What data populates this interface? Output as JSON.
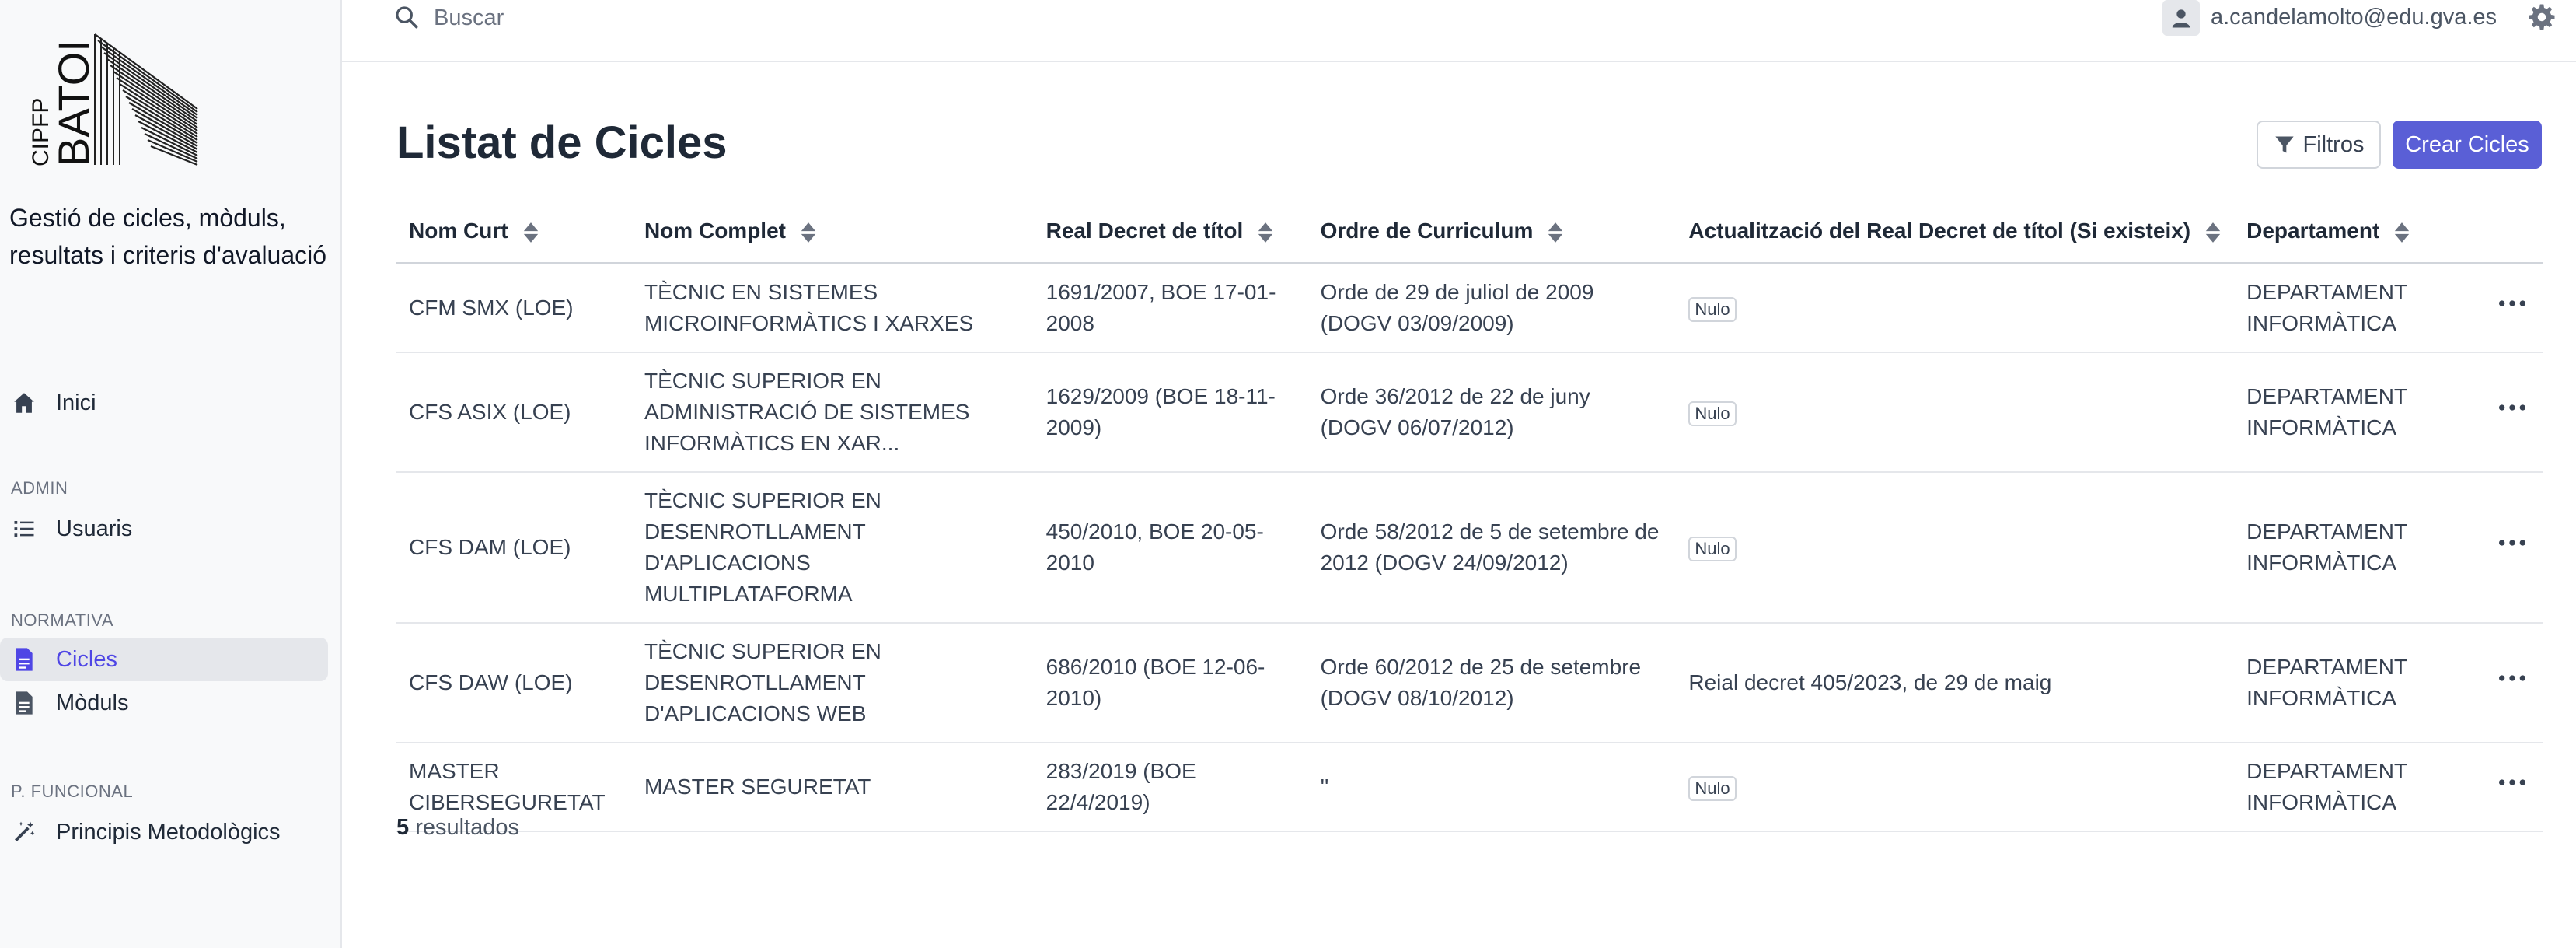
{
  "sidebar": {
    "logo_text": "CIPFP BATOI",
    "tagline": "Gestió de cicles, mòduls, resultats i criteris d'avaluació",
    "items": [
      {
        "label": "Inici",
        "icon": "home-icon"
      },
      {
        "section": "ADMIN"
      },
      {
        "label": "Usuaris",
        "icon": "list-icon"
      },
      {
        "section": "NORMATIVA"
      },
      {
        "label": "Cicles",
        "icon": "document-icon",
        "active": true
      },
      {
        "label": "Mòduls",
        "icon": "document-icon"
      },
      {
        "section": "P. FUNCIONAL"
      },
      {
        "label": "Principis Metodològics",
        "icon": "magic-wand-icon"
      }
    ]
  },
  "topbar": {
    "search_placeholder": "Buscar",
    "user_email": "a.candelamolto@edu.gva.es"
  },
  "page": {
    "title": "Listat de Cicles",
    "filter_label": "Filtros",
    "create_label": "Crear Cicles",
    "accent_color": "#5a5fd6"
  },
  "table": {
    "columns": [
      "Nom Curt",
      "Nom Complet",
      "Real Decret de títol",
      "Ordre de Curriculum",
      "Actualització del Real Decret de títol (Si existeix)",
      "Departament"
    ],
    "rows": [
      {
        "short": "CFM SMX (LOE)",
        "full": "TÈCNIC EN SISTEMES MICROINFORMÀTICS I XARXES",
        "decree": "1691/2007, BOE 17-01-2008",
        "order": "Orde de 29 de juliol de 2009 (DOGV 03/09/2009)",
        "update": "Nulo",
        "update_is_badge": true,
        "dept": "DEPARTAMENT INFORMÀTICA"
      },
      {
        "short": "CFS ASIX (LOE)",
        "full": "TÈCNIC SUPERIOR EN ADMINISTRACIÓ DE SISTEMES INFORMÀTICS EN XAR...",
        "decree": "1629/2009 (BOE 18-11-2009)",
        "order": "Orde 36/2012 de 22 de juny (DOGV 06/07/2012)",
        "update": "Nulo",
        "update_is_badge": true,
        "dept": "DEPARTAMENT INFORMÀTICA"
      },
      {
        "short": "CFS DAM (LOE)",
        "full": "TÈCNIC SUPERIOR EN DESENROTLLAMENT D'APLICACIONS MULTIPLATAFORMA",
        "decree": "450/2010, BOE 20-05-2010",
        "order": "Orde 58/2012 de 5 de setembre de 2012 (DOGV 24/09/2012)",
        "update": "Nulo",
        "update_is_badge": true,
        "dept": "DEPARTAMENT INFORMÀTICA"
      },
      {
        "short": "CFS DAW (LOE)",
        "full": "TÈCNIC SUPERIOR EN DESENROTLLAMENT D'APLICACIONS WEB",
        "decree": "686/2010 (BOE 12-06-2010)",
        "order": "Orde 60/2012 de 25 de setembre (DOGV 08/10/2012)",
        "update": "Reial decret 405/2023, de 29 de maig",
        "update_is_badge": false,
        "dept": "DEPARTAMENT INFORMÀTICA"
      },
      {
        "short": "MASTER CIBERSEGURETAT",
        "full": "MASTER SEGURETAT",
        "decree": "283/2019 (BOE 22/4/2019)",
        "order": "''",
        "update": "Nulo",
        "update_is_badge": true,
        "dept": "DEPARTAMENT INFORMÀTICA"
      }
    ]
  },
  "footer": {
    "count": "5",
    "count_label": "resultados"
  }
}
